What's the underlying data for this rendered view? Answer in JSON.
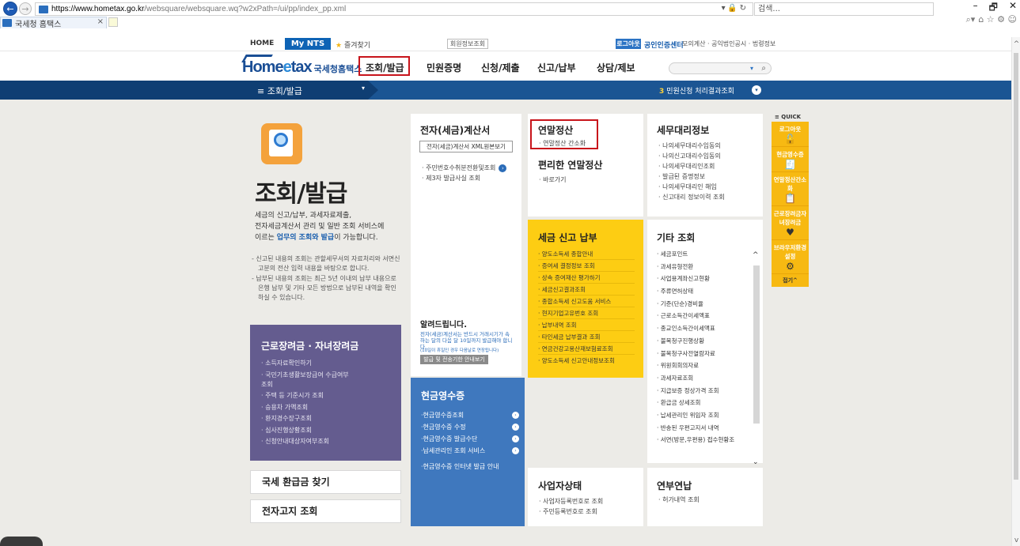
{
  "browser": {
    "url_host": "https://www.hometax.go.kr",
    "url_rest": "/websquare/websquare.wq?w2xPath=/ui/pp/index_pp.xml",
    "address_icons": "▾ 🔒 ↻",
    "search_placeholder": "검색...",
    "tab_title": "국세청 홈택스",
    "tab_close": "×",
    "minimize": "–",
    "maximize": "🗗",
    "close": "✕",
    "search_icon": "⌕▾",
    "tool_icons": "⌂ ☆ ⚙ ☺"
  },
  "topbar": {
    "home": "HOME",
    "mynts": "My NTS",
    "favorites": "즐겨찾기",
    "member_info": "회원정보조회",
    "logout": "로그아웃",
    "cert_center": "공인인증센터",
    "links": "모의계산 · 공익법인공시 · 법령정보"
  },
  "gnb": {
    "logo_text": "Home",
    "logo_e": "e",
    "logo_tax": "tax",
    "logo_kor": "국세청홈택스",
    "items": [
      "조회/발급",
      "민원증명",
      "신청/제출",
      "신고/납부",
      "상담/제보"
    ],
    "search_arrow": "▾",
    "search_icon": "⌕"
  },
  "strip": {
    "menu_title": "≡  조회/발급",
    "caret": "▾",
    "count": "3",
    "status_text": "민원신청 처리결과조회",
    "status_icon": "▾"
  },
  "hero": {
    "title": "조회/발급",
    "desc_1": "세금의 신고/납부, 과세자료제출,",
    "desc_2": "전자세금계산서 관리 및 일반 조회 서비스에",
    "desc_3_pre": "이르는 ",
    "desc_3_hl": "업무의 조회와 발급",
    "desc_3_post": "이 가능합니다.",
    "note_1": "- 신고된 내용의 조회는 관할세무서의 자료처리와 서면신고분의 전산 입력 내용을 바탕으로 합니다.",
    "note_2": "- 납부된 내용의 조회는 최근 5년 이내의 납부 내용으로 은행 납부 및 기타 모든 방법으로 납부된 내역을 확인하실 수 있습니다."
  },
  "purple_panel": {
    "title": "근로장려금 · 자녀장려금",
    "items": [
      "· 소득자료확인하기",
      "· 국민기초생활보장급여 수급여부",
      "  조회",
      "· 주택 등 기준시가 조회",
      "· 승용차 가액조회",
      "· 환지경수장구조회",
      "· 심사진행상황조회",
      "· 신청안내대상자여부조회"
    ]
  },
  "refund_box": "국세 환급금 찾기",
  "etax_notice_box": "전자고지 조회",
  "einvoice": {
    "title": "전자(세금)계산서",
    "xml_button": "전자(세금)계산서 XML원본보기",
    "items": [
      "· 주민번호수취분전환및조회",
      "· 제3자 발급사실 조회"
    ],
    "item_icon": "›"
  },
  "notice": {
    "title": "알려드립니다.",
    "text": "전자(세금)계산서는 반드시 거래시기가 속하는 달의 다음 달 10일까지 발급해야 합니다.",
    "subtext": "(10일이 휴일인 경우 다음날로 연장됩니다)",
    "button": "발급 및 전송기한 안내보기"
  },
  "cash_receipt": {
    "title": "현금영수증",
    "items": [
      "·현금영수증조회",
      "·현금영수증 수정",
      "·현금영수증 발급수단",
      "·납세관리인 조회 서비스",
      "·현금영수증 인터넷 발급 안내"
    ],
    "item_icon": "›"
  },
  "year_end": {
    "title": "연말정산",
    "item": "· 연말정산 간소화",
    "title2": "편리한 연말정산",
    "item2": "· 바로가기"
  },
  "tax_filing": {
    "title": "세금 신고 납부",
    "items": [
      "· 양도소득세 종합안내",
      "· 증여세 결정정보 조회",
      "· 상속 증여재산 평가하기",
      "· 세금신고결과조회",
      "· 종합소득세 신고도움 서비스",
      "· 현지기업고유번호 조회",
      "· 납부내역 조회",
      "· 타인세금 납부결과 조회",
      "· 연금건강고용산재보험료조회",
      "· 양도소득세 신고안내정보조회"
    ]
  },
  "business_status": {
    "title": "사업자상태",
    "items": [
      "· 사업자등록번호로 조회",
      "· 주민등록번호로 조회"
    ]
  },
  "tax_agent": {
    "title": "세무대리정보",
    "items": [
      "· 나의세무대리수임동의",
      "· 나의신고대리수임동의",
      "· 나의세무대리인조회",
      "· 발급된 증명정보",
      "· 나의세무대리인 해임",
      "· 신고대리 정보이력 조회"
    ]
  },
  "other": {
    "title": "기타 조회",
    "items": [
      "· 세금포인트",
      "· 과세유형전환",
      "· 사업용계좌신고현황",
      "· 주류면허상태",
      "· 기준(단순)경비율",
      "· 근로소득간이세액표",
      "· 종교인소득간이세액표",
      "· 불복청구진행상황",
      "· 불복청구사전열람자료",
      "· 위원회회의자료",
      "· 과세자료조회",
      "· 지급보증 정상가격 조회",
      "· 환급금 상세조회",
      "· 납세관리인 위임자 조회",
      "· 반송된 우편고지서 내역",
      "· 서면(방문,우편용) 접수현황조"
    ],
    "scroll_up": "^",
    "scroll_down": "⌄"
  },
  "annual_salary": {
    "title": "연부연납",
    "items": [
      "· 허가내역 조회"
    ]
  },
  "quick": {
    "head": "≡ QUICK",
    "items": [
      {
        "label": "로그아웃",
        "icon": "🔓"
      },
      {
        "label": "현금영수증",
        "icon": "🧾"
      },
      {
        "label": "연말정산간소화",
        "icon": "📋"
      },
      {
        "label": "근로장려금자녀장려금",
        "icon": "♥"
      },
      {
        "label": "브라우저환경설정",
        "icon": "⚙"
      }
    ],
    "close": "접기^"
  }
}
